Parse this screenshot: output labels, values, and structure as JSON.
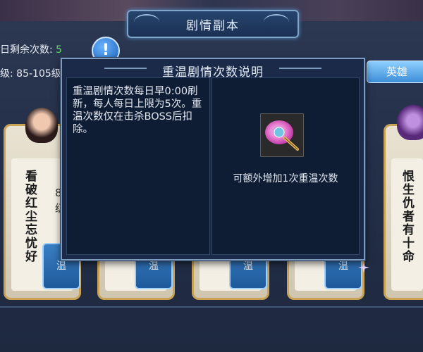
{
  "header": {
    "title": "剧情副本"
  },
  "stats": {
    "remaining_label": "日剩余次数:",
    "remaining_value": "5",
    "level_label": "级: 85-105级"
  },
  "hero_button": {
    "label": "英雄"
  },
  "dialog": {
    "title": "重温剧情次数说明",
    "description": "重温剧情次数每日早0:00刷新，每人每日上限为5次。重温次数仅在击杀BOSS后扣除。",
    "bonus_text": "可额外增加1次重温次数",
    "item_icon": "feather-fan-icon"
  },
  "cards": [
    {
      "title": "看破红尘忘忧好",
      "level": "8",
      "level2": "级",
      "slot_label": "温"
    },
    {
      "title": "",
      "slot_label": "温"
    },
    {
      "title": "",
      "slot_label": "温"
    },
    {
      "title": "",
      "slot_label": "温"
    },
    {
      "title": "恨生仇者有十命",
      "slot_label": ""
    }
  ],
  "colors": {
    "dialog_bg": "#1a2a48",
    "accent_green": "#5fe05f",
    "card_gold": "#c9a256",
    "button_blue": "#3d8ed8"
  }
}
